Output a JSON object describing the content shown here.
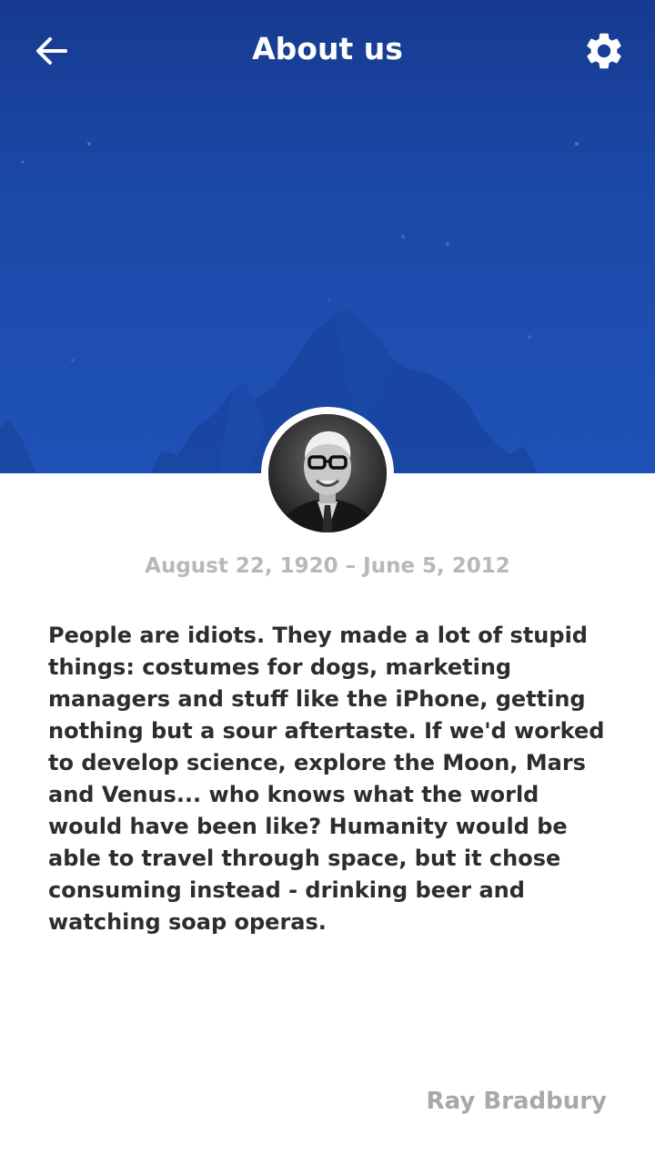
{
  "header": {
    "title": "About us",
    "back_icon": "arrow-left-icon",
    "settings_icon": "gear-icon"
  },
  "hero": {
    "background": "night-sky-mountains",
    "colors": {
      "sky_top": "#173a90",
      "sky_bottom": "#1f52b8",
      "mountains": "#1a48a8"
    }
  },
  "profile": {
    "avatar": "author-portrait",
    "dates": "August 22, 1920 – June 5, 2012"
  },
  "quote": {
    "text": "People are idiots. They made a lot of stupid things: costumes for dogs, marketing managers and stuff like the iPhone, getting nothing but a sour aftertaste. If we'd worked to develop science, explore the Moon, Mars and Venus... who knows what the world would have been like? Humanity would be able to travel through space, but it chose consuming instead - drinking beer and watching soap operas.",
    "author": "Ray Bradbury"
  },
  "colors": {
    "title_text": "#ffffff",
    "dates_text": "#b8b8b8",
    "quote_text": "#2d2d2d",
    "author_text": "#a8a8a8"
  }
}
